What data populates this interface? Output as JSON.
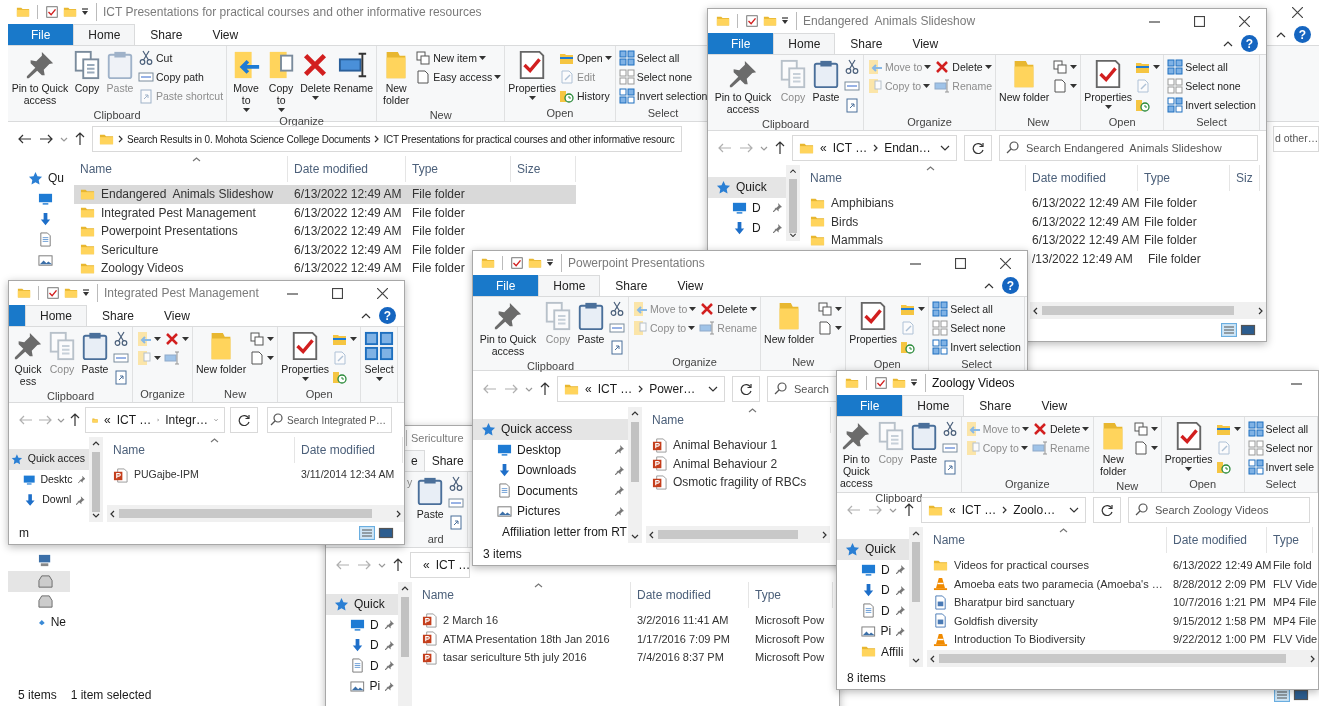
{
  "windows": [
    {
      "title": "ICT Presentations for practical courses and other informative resources",
      "active": false,
      "caption_buttons": [
        {
          "kind": "close"
        }
      ],
      "tabs": [
        {
          "kind": "file",
          "label": "File",
          "selected": false
        },
        {
          "label": "Home",
          "selected": true
        },
        {
          "label": "Share",
          "selected": false
        },
        {
          "label": "View",
          "selected": false
        }
      ],
      "help": "?",
      "ribbon": [
        {
          "label": "Clipboard",
          "columns": [
            [
              {
                "kind": "pin",
                "label": "Pin to Quick access",
                "disabled": false
              }
            ],
            [
              {
                "kind": "copy",
                "label": "Copy",
                "disabled": false
              }
            ],
            [
              {
                "kind": "paste",
                "label": "Paste",
                "disabled": true
              }
            ],
            [
              {
                "kind": "cut",
                "label": "Cut",
                "disabled": false
              },
              {
                "kind": "copypath",
                "label": "Copy path",
                "disabled": false
              },
              {
                "kind": "shortcut",
                "label": "Paste shortcut",
                "disabled": true
              }
            ]
          ]
        },
        {
          "label": "Organize",
          "columns": [
            [
              {
                "kind": "move",
                "label": "Move to",
                "menu": true,
                "disabled": false
              }
            ],
            [
              {
                "kind": "copyto",
                "label": "Copy to",
                "menu": true,
                "disabled": false
              }
            ],
            [
              {
                "kind": "delete",
                "label": "Delete",
                "menu": true,
                "disabled": false
              }
            ],
            [
              {
                "kind": "rename",
                "label": "Rename",
                "disabled": false
              }
            ]
          ]
        },
        {
          "label": "New",
          "columns": [
            [
              {
                "kind": "newfolder",
                "label": "New folder",
                "disabled": false
              }
            ],
            [
              {
                "kind": "newitem",
                "label": "New item",
                "menu": true,
                "disabled": false
              },
              {
                "kind": "easyaccess",
                "label": "Easy access",
                "menu": true,
                "disabled": false
              }
            ]
          ]
        },
        {
          "label": "Open",
          "columns": [
            [
              {
                "kind": "properties",
                "label": "Properties",
                "menu": true,
                "disabled": false
              }
            ],
            [
              {
                "kind": "open",
                "label": "Open",
                "menu": true,
                "disabled": false
              },
              {
                "kind": "edit",
                "label": "Edit",
                "disabled": true
              },
              {
                "kind": "history",
                "label": "History",
                "disabled": false
              }
            ]
          ]
        },
        {
          "label": "Select",
          "columns": [
            [
              {
                "kind": "selectall",
                "label": "Select all",
                "disabled": false
              },
              {
                "kind": "selectnone",
                "label": "Select none",
                "disabled": false
              },
              {
                "kind": "invert",
                "label": "Invert selection",
                "disabled": false
              }
            ]
          ]
        }
      ],
      "address": {
        "back_enabled": true,
        "crumbs": [
          "Search Results in 0. Mohota Science College Documents",
          "ICT Presentations for practical courses and other informative resourc"
        ]
      },
      "search": {
        "placeholder": "d other…"
      },
      "nav": [
        {
          "kind": "quick",
          "label": "Qu",
          "selected": false
        },
        {
          "kind": "desktop",
          "selected": false
        },
        {
          "kind": "downloads",
          "selected": false
        },
        {
          "kind": "documents",
          "selected": false
        },
        {
          "kind": "pictures",
          "selected": false
        },
        {
          "kind": "pc",
          "selected": false
        },
        {
          "kind": "drive",
          "selected": true
        },
        {
          "kind": "drive",
          "selected": false
        },
        {
          "kind": "network",
          "label": "Ne",
          "selected": false
        }
      ],
      "columns": [
        "Name",
        "Date modified",
        "Type",
        "Size"
      ],
      "rows": [
        {
          "kind": "folder",
          "cells": [
            "Endangered  Animals Slideshow",
            "6/13/2022 12:49 AM",
            "File folder"
          ],
          "selected": true
        },
        {
          "kind": "folder",
          "cells": [
            "Integrated Pest Management",
            "6/13/2022 12:49 AM",
            "File folder"
          ],
          "selected": false
        },
        {
          "kind": "folder",
          "cells": [
            "Powerpoint Presentations",
            "6/13/2022 12:49 AM",
            "File folder"
          ],
          "selected": false
        },
        {
          "kind": "folder",
          "cells": [
            "Sericulture",
            "6/13/2022 12:49 AM",
            "File folder"
          ],
          "selected": false
        },
        {
          "kind": "folder",
          "cells": [
            "Zoology Videos",
            "6/13/2022 12:49 AM",
            "File folder"
          ],
          "selected": false
        }
      ],
      "status": [
        "5 items",
        "1 item selected"
      ]
    },
    {
      "title": "Endangered  Animals Slideshow",
      "active": false,
      "caption_buttons": [
        {
          "kind": "minimize"
        },
        {
          "kind": "maximize"
        },
        {
          "kind": "close"
        }
      ],
      "tabs": [
        {
          "kind": "file",
          "label": "File",
          "selected": false
        },
        {
          "label": "Home",
          "selected": true
        },
        {
          "label": "Share",
          "selected": false
        },
        {
          "label": "View",
          "selected": false
        }
      ],
      "help": "?",
      "ribbon": [
        {
          "label": "Clipboard",
          "columns": [
            [
              {
                "kind": "pin",
                "label": "Pin to Quick access",
                "disabled": false
              }
            ],
            [
              {
                "kind": "copy",
                "label": "Copy",
                "disabled": true
              }
            ],
            [
              {
                "kind": "paste",
                "label": "Paste",
                "disabled": false
              }
            ],
            [
              {
                "kind": "cut",
                "disabled": false
              },
              {
                "kind": "copypath",
                "disabled": false
              },
              {
                "kind": "shortcut",
                "disabled": false
              }
            ]
          ]
        },
        {
          "label": "Organize",
          "columns": [
            [
              {
                "kind": "move",
                "label": "Move to",
                "menu": true,
                "disabled": true
              },
              {
                "kind": "copyto",
                "label": "Copy to",
                "menu": true,
                "disabled": true
              }
            ],
            [
              {
                "kind": "delete",
                "label": "Delete",
                "menu": true,
                "disabled": false
              },
              {
                "kind": "rename",
                "label": "Rename",
                "disabled": true
              }
            ]
          ]
        },
        {
          "label": "New",
          "columns": [
            [
              {
                "kind": "newfolder",
                "label": "New folder",
                "disabled": false
              }
            ],
            [
              {
                "kind": "newitem",
                "menu": true,
                "disabled": false
              },
              {
                "kind": "easyaccess",
                "menu": true,
                "disabled": false
              }
            ]
          ]
        },
        {
          "label": "Open",
          "columns": [
            [
              {
                "kind": "properties",
                "label": "Properties",
                "menu": true,
                "disabled": false
              }
            ],
            [
              {
                "kind": "open",
                "menu": true,
                "disabled": false
              },
              {
                "kind": "edit",
                "disabled": true
              },
              {
                "kind": "history",
                "disabled": false
              }
            ]
          ]
        },
        {
          "label": "Select",
          "columns": [
            [
              {
                "kind": "selectall",
                "label": "Select all",
                "disabled": false
              },
              {
                "kind": "selectnone",
                "label": "Select none",
                "disabled": false
              },
              {
                "kind": "invert",
                "label": "Invert selection",
                "disabled": false
              }
            ]
          ]
        }
      ],
      "address": {
        "back_enabled": false,
        "overflow": "«",
        "crumbs": [
          "ICT …",
          "Endan…"
        ]
      },
      "search": {
        "placeholder": "Search Endangered  Animals Slideshow"
      },
      "nav": [
        {
          "kind": "quick",
          "label": "Quick",
          "selected": true,
          "pinned": false
        },
        {
          "kind": "desktop",
          "label": "D",
          "selected": false,
          "pinned": true
        },
        {
          "kind": "downloads",
          "label": "D",
          "selected": false,
          "pinned": true
        }
      ],
      "columns": [
        "Name",
        "Date modified",
        "Type",
        "Siz"
      ],
      "rows": [
        {
          "kind": "folder",
          "cells": [
            "Amphibians",
            "6/13/2022 12:49 AM",
            "File folder"
          ],
          "selected": false
        },
        {
          "kind": "folder",
          "cells": [
            "Birds",
            "6/13/2022 12:49 AM",
            "File folder"
          ],
          "selected": false
        },
        {
          "kind": "folder",
          "cells": [
            "Mammals",
            "6/13/2022 12:49 AM",
            "File folder"
          ],
          "selected": false
        },
        {
          "cells": [
            "",
            "/13/2022 12:49 AM",
            "File folder"
          ],
          "selected": false
        }
      ]
    },
    {
      "title": "Sericulture",
      "active": false,
      "tabs": [
        {
          "label": "e",
          "selected": true
        },
        {
          "label": "Share",
          "selected": false
        }
      ],
      "ribbon": [
        {
          "label": "ard",
          "columns": [
            [
              {
                "kind": "fragment",
                "label": "y",
                "disabled": true
              }
            ],
            [
              {
                "kind": "paste",
                "label": "Paste",
                "disabled": false
              }
            ],
            [
              {
                "kind": "cut",
                "disabled": false
              },
              {
                "kind": "copypath",
                "disabled": false
              },
              {
                "kind": "shortcut",
                "disabled": false
              }
            ]
          ]
        }
      ],
      "address": {
        "back_enabled": false,
        "overflow": "«",
        "crumbs": [
          "ICT …"
        ]
      },
      "nav": [
        {
          "kind": "quick",
          "label": "Quick",
          "selected": true,
          "pinned": false
        },
        {
          "kind": "desktop",
          "label": "D",
          "selected": false,
          "pinned": true
        },
        {
          "kind": "downloads",
          "label": "D",
          "selected": false,
          "pinned": true
        },
        {
          "kind": "documents",
          "label": "D",
          "selected": false,
          "pinned": true
        },
        {
          "kind": "pictures",
          "label": "Pi",
          "selected": false,
          "pinned": true
        }
      ],
      "columns": [
        "Name",
        "Date modified",
        "Type"
      ],
      "rows": [
        {
          "kind": "ppt",
          "cells": [
            "2 March 16",
            "3/2/2016 11:41 AM",
            "Microsoft Pow"
          ],
          "selected": false
        },
        {
          "kind": "ppt",
          "cells": [
            "ATMA Presentation 18th Jan 2016",
            "1/17/2016 7:09 PM",
            "Microsoft Pow"
          ],
          "selected": false
        },
        {
          "kind": "ppt",
          "cells": [
            "tasar sericulture 5th july 2016",
            "7/4/2016 8:37 PM",
            "Microsoft Pow"
          ],
          "selected": false
        }
      ]
    },
    {
      "title": "Integrated Pest Management",
      "active": false,
      "caption_buttons": [
        {
          "kind": "minimize"
        },
        {
          "kind": "maximize"
        },
        {
          "kind": "close"
        }
      ],
      "tabs": [
        {
          "kind": "file",
          "selected": false
        },
        {
          "label": "Home",
          "selected": true
        },
        {
          "label": "Share",
          "selected": false
        },
        {
          "label": "View",
          "selected": false
        }
      ],
      "help": "?",
      "ribbon": [
        {
          "label": "Clipboard",
          "columns": [
            [
              {
                "kind": "pin",
                "label": "Quick ess",
                "disabled": false
              }
            ],
            [
              {
                "kind": "copy",
                "label": "Copy",
                "disabled": true
              }
            ],
            [
              {
                "kind": "paste",
                "label": "Paste",
                "disabled": false
              }
            ],
            [
              {
                "kind": "cut",
                "disabled": false
              },
              {
                "kind": "copypath",
                "disabled": false
              },
              {
                "kind": "shortcut",
                "disabled": false
              }
            ]
          ]
        },
        {
          "label": "Organize",
          "columns": [
            [
              {
                "kind": "move",
                "menu": true,
                "disabled": true
              },
              {
                "kind": "copyto",
                "menu": true,
                "disabled": true
              }
            ],
            [
              {
                "kind": "delete",
                "menu": true,
                "disabled": false
              },
              {
                "kind": "rename",
                "disabled": true
              }
            ]
          ]
        },
        {
          "label": "New",
          "columns": [
            [
              {
                "kind": "newfolder",
                "label": "New folder",
                "disabled": false
              }
            ],
            [
              {
                "kind": "newitem",
                "menu": true,
                "disabled": false
              },
              {
                "kind": "easyaccess",
                "menu": true,
                "disabled": false
              }
            ]
          ]
        },
        {
          "label": "Open",
          "columns": [
            [
              {
                "kind": "properties",
                "label": "Properties",
                "menu": true,
                "disabled": false
              }
            ],
            [
              {
                "kind": "open",
                "menu": true,
                "disabled": false
              },
              {
                "kind": "edit",
                "disabled": true
              },
              {
                "kind": "history",
                "disabled": false
              }
            ]
          ]
        },
        {
          "columns": [
            [
              {
                "kind": "select",
                "label": "Select",
                "menu": true,
                "disabled": false
              }
            ]
          ]
        }
      ],
      "address": {
        "back_enabled": false,
        "overflow": "«",
        "crumbs": [
          "ICT …",
          "Integr…"
        ]
      },
      "search": {
        "placeholder": "Search Integrated P…"
      },
      "nav": [
        {
          "kind": "quick",
          "label": "Quick acces",
          "selected": true,
          "pinned": false
        },
        {
          "kind": "desktop",
          "label": "Desktc",
          "selected": false,
          "pinned": true
        },
        {
          "kind": "downloads",
          "label": "Downl",
          "selected": false,
          "pinned": true
        }
      ],
      "columns": [
        "Name",
        "Date modified"
      ],
      "rows": [
        {
          "kind": "ppt",
          "cells": [
            "PUGajbe-IPM",
            "3/11/2014 12:34 AM"
          ],
          "selected": false
        }
      ],
      "status": [
        "m"
      ]
    },
    {
      "title": "Powerpoint Presentations",
      "active": false,
      "caption_buttons": [
        {
          "kind": "minimize"
        },
        {
          "kind": "maximize"
        },
        {
          "kind": "close"
        }
      ],
      "tabs": [
        {
          "kind": "file",
          "label": "File",
          "selected": false
        },
        {
          "label": "Home",
          "selected": true
        },
        {
          "label": "Share",
          "selected": false
        },
        {
          "label": "View",
          "selected": false
        }
      ],
      "help": "?",
      "ribbon": [
        {
          "label": "Clipboard",
          "columns": [
            [
              {
                "kind": "pin",
                "label": "Pin to Quick access",
                "disabled": false
              }
            ],
            [
              {
                "kind": "copy",
                "label": "Copy",
                "disabled": true
              }
            ],
            [
              {
                "kind": "paste",
                "label": "Paste",
                "disabled": false
              }
            ],
            [
              {
                "kind": "cut",
                "disabled": false
              },
              {
                "kind": "copypath",
                "disabled": false
              },
              {
                "kind": "shortcut",
                "disabled": false
              }
            ]
          ]
        },
        {
          "label": "Organize",
          "columns": [
            [
              {
                "kind": "move",
                "label": "Move to",
                "menu": true,
                "disabled": true
              },
              {
                "kind": "copyto",
                "label": "Copy to",
                "menu": true,
                "disabled": true
              }
            ],
            [
              {
                "kind": "delete",
                "label": "Delete",
                "menu": true,
                "disabled": false
              },
              {
                "kind": "rename",
                "label": "Rename",
                "disabled": true
              }
            ]
          ]
        },
        {
          "label": "New",
          "columns": [
            [
              {
                "kind": "newfolder",
                "label": "New folder",
                "disabled": false
              }
            ],
            [
              {
                "kind": "newitem",
                "menu": true,
                "disabled": false
              },
              {
                "kind": "easyaccess",
                "menu": true,
                "disabled": false
              }
            ]
          ]
        },
        {
          "label": "Open",
          "columns": [
            [
              {
                "kind": "properties",
                "label": "Properties",
                "disabled": false
              }
            ],
            [
              {
                "kind": "open",
                "menu": true,
                "disabled": false
              },
              {
                "kind": "edit",
                "disabled": true
              },
              {
                "kind": "history",
                "disabled": false
              }
            ]
          ]
        },
        {
          "label": "Select",
          "columns": [
            [
              {
                "kind": "selectall",
                "label": "Select all",
                "disabled": false
              },
              {
                "kind": "selectnone",
                "label": "Select none",
                "disabled": false
              },
              {
                "kind": "invert",
                "label": "Invert selection",
                "disabled": false
              }
            ]
          ]
        }
      ],
      "address": {
        "back_enabled": false,
        "overflow": "«",
        "crumbs": [
          "ICT …",
          "Power…"
        ]
      },
      "search": {
        "placeholder": "Search"
      },
      "nav": [
        {
          "kind": "quick",
          "label": "Quick access",
          "selected": true,
          "pinned": false
        },
        {
          "kind": "desktop",
          "label": "Desktop",
          "selected": false,
          "pinned": true
        },
        {
          "kind": "downloads",
          "label": "Downloads",
          "selected": false,
          "pinned": true
        },
        {
          "kind": "documents",
          "label": "Documents",
          "selected": false,
          "pinned": true
        },
        {
          "kind": "pictures",
          "label": "Pictures",
          "selected": false,
          "pinned": true
        },
        {
          "kind": "folder",
          "label": "Affiliation letter from RT",
          "selected": false,
          "pinned": false
        }
      ],
      "columns": [
        "Name"
      ],
      "rows": [
        {
          "kind": "ppt",
          "cells": [
            "Animal Behaviour 1"
          ],
          "selected": false
        },
        {
          "kind": "ppt",
          "cells": [
            "Animal Behaviour 2"
          ],
          "selected": false
        },
        {
          "kind": "ppt",
          "cells": [
            "Osmotic fragility of RBCs"
          ],
          "selected": false
        }
      ],
      "status": [
        "3 items"
      ]
    },
    {
      "title": "Zoology Videos",
      "active": true,
      "caption_buttons": [
        {
          "kind": "minimize"
        }
      ],
      "tabs": [
        {
          "kind": "file",
          "label": "File",
          "selected": false
        },
        {
          "label": "Home",
          "selected": true
        },
        {
          "label": "Share",
          "selected": false
        },
        {
          "label": "View",
          "selected": false
        }
      ],
      "ribbon": [
        {
          "label": "Clipboard",
          "columns": [
            [
              {
                "kind": "pin",
                "label": "Pin to Quick access",
                "disabled": false
              }
            ],
            [
              {
                "kind": "copy",
                "label": "Copy",
                "disabled": true
              }
            ],
            [
              {
                "kind": "paste",
                "label": "Paste",
                "disabled": false
              }
            ],
            [
              {
                "kind": "cut",
                "disabled": false
              },
              {
                "kind": "copypath",
                "disabled": false
              },
              {
                "kind": "shortcut",
                "disabled": false
              }
            ]
          ]
        },
        {
          "label": "Organize",
          "columns": [
            [
              {
                "kind": "move",
                "label": "Move to",
                "menu": true,
                "disabled": true
              },
              {
                "kind": "copyto",
                "label": "Copy to",
                "menu": true,
                "disabled": true
              }
            ],
            [
              {
                "kind": "delete",
                "label": "Delete",
                "menu": true,
                "disabled": false
              },
              {
                "kind": "rename",
                "label": "Rename",
                "disabled": true
              }
            ]
          ]
        },
        {
          "label": "New",
          "columns": [
            [
              {
                "kind": "newfolder",
                "label": "New folder",
                "disabled": false
              }
            ],
            [
              {
                "kind": "newitem",
                "menu": true,
                "disabled": false
              },
              {
                "kind": "easyaccess",
                "menu": true,
                "disabled": false
              }
            ]
          ]
        },
        {
          "label": "Open",
          "columns": [
            [
              {
                "kind": "properties",
                "label": "Properties",
                "menu": true,
                "disabled": false
              }
            ],
            [
              {
                "kind": "open",
                "menu": true,
                "disabled": false
              },
              {
                "kind": "edit",
                "disabled": true
              },
              {
                "kind": "history",
                "disabled": false
              }
            ]
          ]
        },
        {
          "label": "Select",
          "columns": [
            [
              {
                "kind": "selectall",
                "label": "Select all",
                "disabled": false
              },
              {
                "kind": "selectnone",
                "label": "Select nor",
                "disabled": false
              },
              {
                "kind": "invert",
                "label": "Invert sele",
                "disabled": false
              }
            ]
          ]
        }
      ],
      "address": {
        "back_enabled": false,
        "overflow": "«",
        "crumbs": [
          "ICT …",
          "Zoolo…"
        ]
      },
      "search": {
        "placeholder": "Search Zoology Videos"
      },
      "nav": [
        {
          "kind": "quick",
          "label": "Quick",
          "selected": true,
          "pinned": false
        },
        {
          "kind": "desktop",
          "label": "D",
          "selected": false,
          "pinned": true
        },
        {
          "kind": "downloads",
          "label": "D",
          "selected": false,
          "pinned": true
        },
        {
          "kind": "documents",
          "label": "D",
          "selected": false,
          "pinned": true
        },
        {
          "kind": "pictures",
          "label": "Pi",
          "selected": false,
          "pinned": true
        },
        {
          "kind": "folder",
          "label": "Affili",
          "selected": false,
          "pinned": false
        }
      ],
      "columns": [
        "Name",
        "Date modified",
        "Type"
      ],
      "rows": [
        {
          "kind": "folder",
          "cells": [
            "Videos for practical courses",
            "6/13/2022 12:49 AM",
            "File fold"
          ],
          "selected": false
        },
        {
          "kind": "vlc",
          "cells": [
            "Amoeba eats two paramecia (Amoeba's …",
            "8/28/2012 2:09 PM",
            "FLV Vide"
          ],
          "selected": false
        },
        {
          "kind": "mp4",
          "cells": [
            "Bharatpur bird sanctuary",
            "10/7/2016 1:21 PM",
            "MP4 File"
          ],
          "selected": false
        },
        {
          "kind": "mp4",
          "cells": [
            "Goldfish diversity",
            "9/15/2012 1:58 PM",
            "MP4 File"
          ],
          "selected": false
        },
        {
          "kind": "vlc",
          "cells": [
            "Introduction To Biodiversity",
            "9/22/2012 1:00 PM",
            "FLV Vide"
          ],
          "selected": false
        }
      ],
      "status": [
        "8 items"
      ]
    }
  ]
}
